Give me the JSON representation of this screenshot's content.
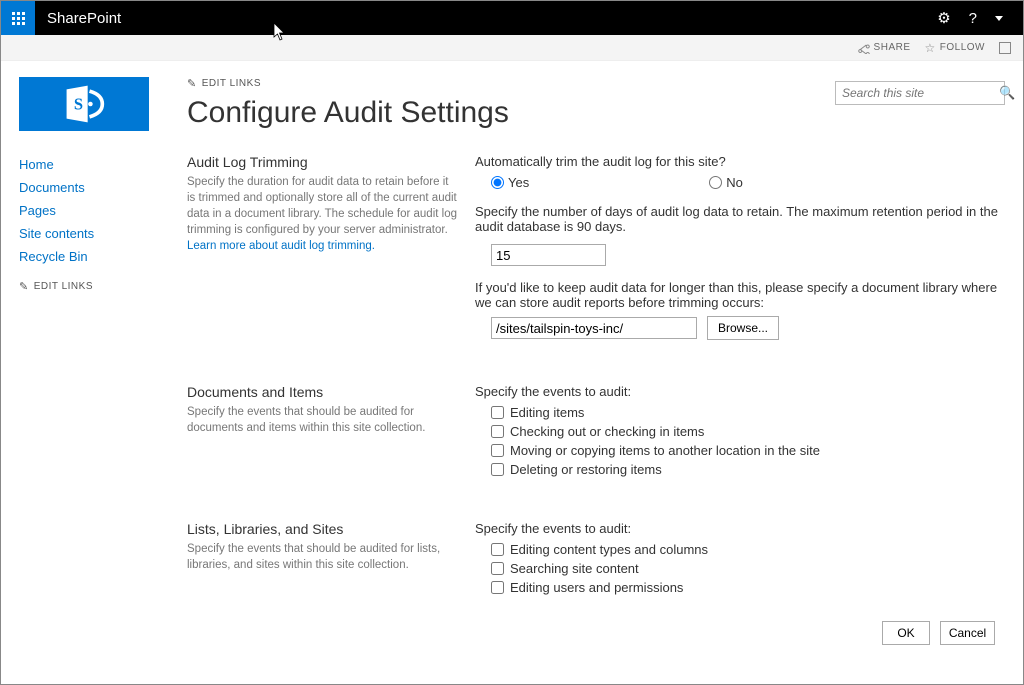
{
  "topbar": {
    "app_name": "SharePoint",
    "settings_icon": "⚙",
    "help_icon": "?"
  },
  "actionbar": {
    "share": "SHARE",
    "follow": "FOLLOW"
  },
  "nav": {
    "items": [
      "Home",
      "Documents",
      "Pages",
      "Site contents",
      "Recycle Bin"
    ],
    "edit_links_label": "EDIT LINKS"
  },
  "header": {
    "edit_links_label": "EDIT LINKS",
    "page_title": "Configure Audit Settings",
    "search_placeholder": "Search this site"
  },
  "sections": {
    "trimming": {
      "title": "Audit Log Trimming",
      "desc_pre": "Specify the duration for audit data to retain before it is trimmed and optionally store all of the current audit data in a document library. The schedule for audit log trimming is configured by your server administrator. ",
      "learn_more": "Learn more about audit log trimming.",
      "q_auto_trim": "Automatically trim the audit log for this site?",
      "yes_label": "Yes",
      "no_label": "No",
      "q_days": "Specify the number of days of audit log data to retain. The maximum retention period in the audit database is 90 days.",
      "days_value": "15",
      "q_lib": "If you'd like to keep audit data for longer than this, please specify a document library where we can store audit reports before trimming occurs:",
      "lib_value": "/sites/tailspin-toys-inc/",
      "browse_label": "Browse..."
    },
    "docs": {
      "title": "Documents and Items",
      "desc": "Specify the events that should be audited for documents and items within this site collection.",
      "events_label": "Specify the events to audit:",
      "events": [
        "Editing items",
        "Checking out or checking in items",
        "Moving or copying items to another location in the site",
        "Deleting or restoring items"
      ]
    },
    "lists": {
      "title": "Lists, Libraries, and Sites",
      "desc": "Specify the events that should be audited for lists, libraries, and sites within this site collection.",
      "events_label": "Specify the events to audit:",
      "events": [
        "Editing content types and columns",
        "Searching site content",
        "Editing users and permissions"
      ]
    }
  },
  "buttons": {
    "ok": "OK",
    "cancel": "Cancel"
  }
}
